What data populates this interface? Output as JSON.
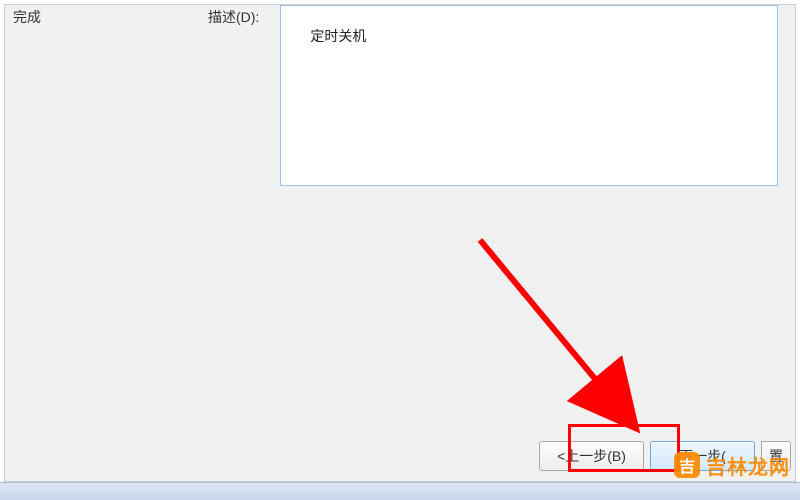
{
  "sidebar": {
    "step_complete": "完成"
  },
  "form": {
    "description_label": "描述(D):",
    "description_value": "定时关机"
  },
  "buttons": {
    "back": "<上一步(B)",
    "next": "下一步(",
    "cut_fragment": "置"
  },
  "watermark": {
    "badge": "吉",
    "text": "吉林龙网"
  },
  "annotation": {
    "highlight_color": "#ff0000"
  }
}
